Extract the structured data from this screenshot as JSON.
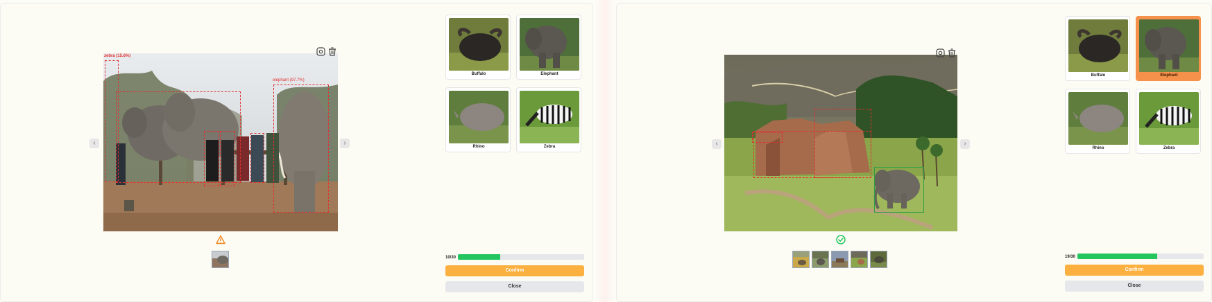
{
  "left_panel": {
    "detections": [
      {
        "label": "zebra (15.6%)"
      },
      {
        "label": "elephant (97.7%)"
      }
    ],
    "status": "warning",
    "status_icon": "warning-triangle-icon",
    "thumbnails_count": 1,
    "progress": {
      "label": "10/30",
      "fraction": 0.3333
    },
    "confirm_label": "Confirm",
    "close_label": "Close",
    "cards": [
      {
        "label": "Buffalo",
        "selected": false
      },
      {
        "label": "Elephant",
        "selected": false
      },
      {
        "label": "Rhino",
        "selected": false
      },
      {
        "label": "Zebra",
        "selected": false
      }
    ]
  },
  "right_panel": {
    "status": "success",
    "status_icon": "check-circle-icon",
    "thumbnails_count": 5,
    "progress": {
      "label": "19/30",
      "fraction": 0.6333
    },
    "confirm_label": "Confirm",
    "close_label": "Close",
    "cards": [
      {
        "label": "Buffalo",
        "selected": false
      },
      {
        "label": "Elephant",
        "selected": true
      },
      {
        "label": "Rhino",
        "selected": false
      },
      {
        "label": "Zebra",
        "selected": false
      }
    ]
  },
  "colors": {
    "accent_orange": "#f5914b",
    "confirm_yellow": "#fbb040",
    "progress_green": "#22c55e",
    "bbox_red": "#e03030",
    "bbox_green": "#2f9e44",
    "warning_orange": "#f08a24",
    "success_green": "#22c55e"
  }
}
